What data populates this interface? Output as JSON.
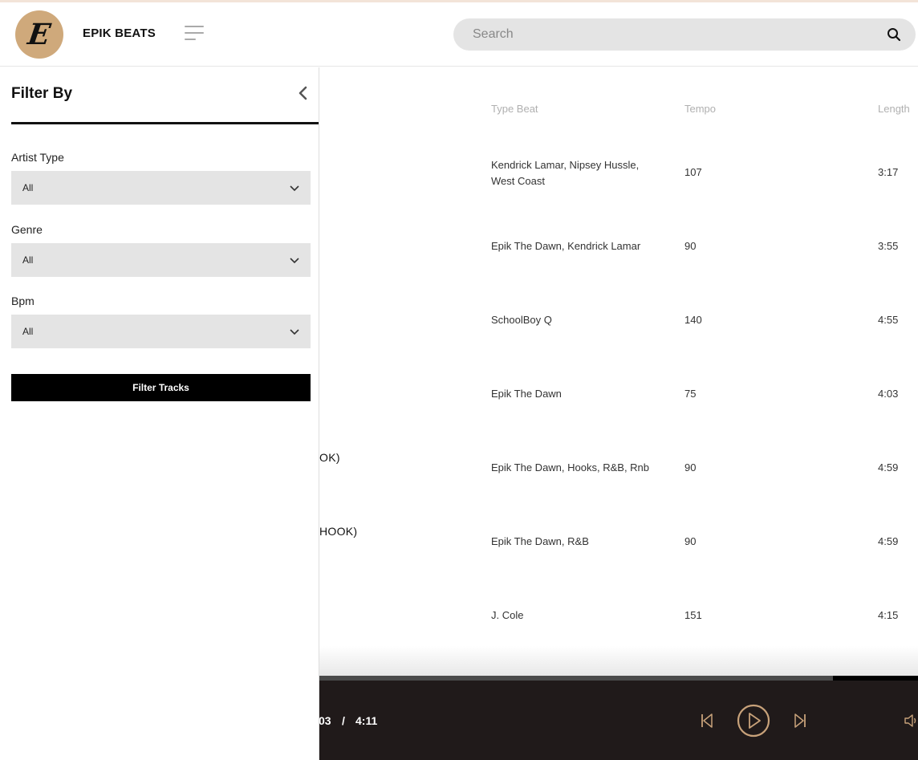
{
  "header": {
    "brand": "EPIK BEATS",
    "logo_letter": "E",
    "search_placeholder": "Search"
  },
  "sidebar": {
    "title": "Filter By",
    "filters": [
      {
        "label": "Artist Type",
        "value": "All"
      },
      {
        "label": "Genre",
        "value": "All"
      },
      {
        "label": "Bpm",
        "value": "All"
      }
    ],
    "filter_button": "Filter Tracks"
  },
  "table": {
    "columns": {
      "type_beat": "Type Beat",
      "tempo": "Tempo",
      "length": "Length"
    },
    "rows": [
      {
        "name_fragment": "",
        "type_beat": "Kendrick Lamar, Nipsey Hussle, West Coast",
        "tempo": "107",
        "length": "3:17"
      },
      {
        "name_fragment": "",
        "type_beat": "Epik The Dawn, Kendrick Lamar",
        "tempo": "90",
        "length": "3:55"
      },
      {
        "name_fragment": "",
        "type_beat": "SchoolBoy Q",
        "tempo": "140",
        "length": "4:55"
      },
      {
        "name_fragment": "",
        "type_beat": "Epik The Dawn",
        "tempo": "75",
        "length": "4:03"
      },
      {
        "name_fragment": "OK)",
        "type_beat": "Epik The Dawn, Hooks, R&B, Rnb",
        "tempo": "90",
        "length": "4:59"
      },
      {
        "name_fragment": "HOOK)",
        "type_beat": "Epik The Dawn, R&B",
        "tempo": "90",
        "length": "4:59"
      },
      {
        "name_fragment": "",
        "type_beat": "J. Cole",
        "tempo": "151",
        "length": "4:15"
      }
    ]
  },
  "player": {
    "elapsed_fragment": "03",
    "separator": "/",
    "duration": "4:11",
    "progress": 0.858,
    "accent_color": "#c8a27a"
  },
  "colors": {
    "logo_bg": "#cfa97b",
    "player_bg": "#201a1a",
    "search_bg": "#e4e4e4"
  }
}
